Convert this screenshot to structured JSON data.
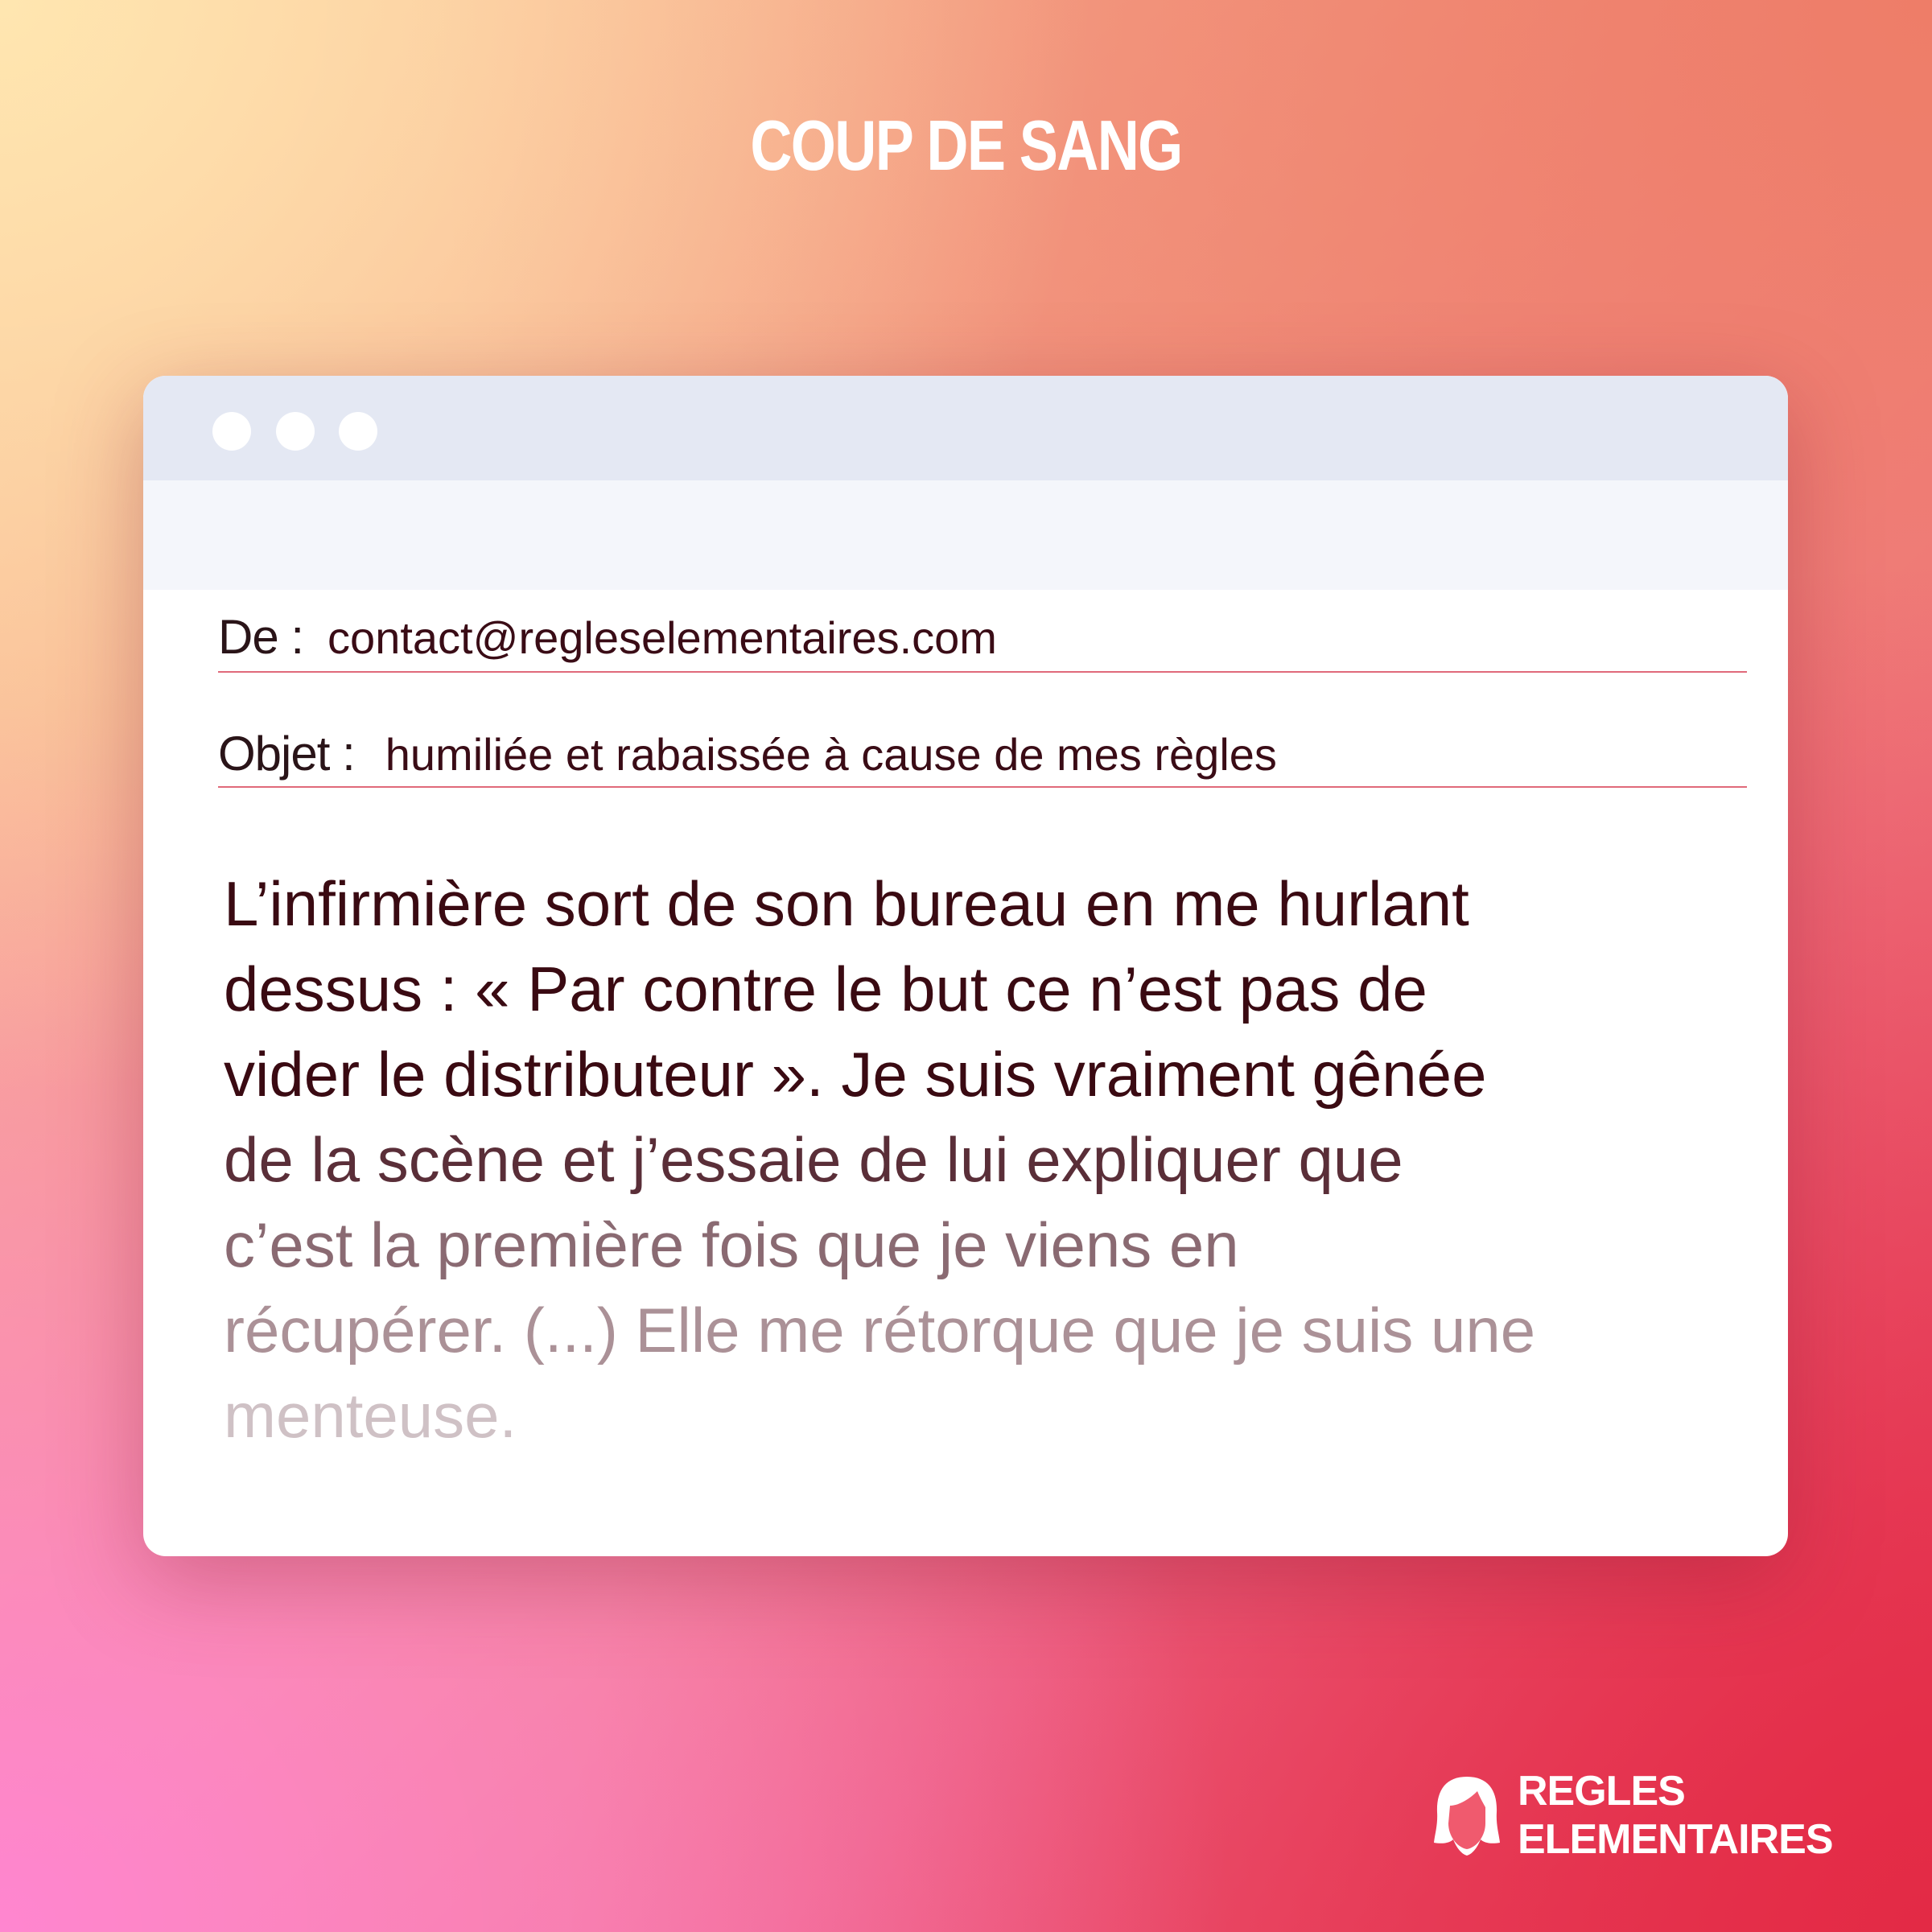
{
  "header": {
    "title": "COUP DE SANG"
  },
  "email": {
    "from_label": "De :",
    "from_value": "contact@regleselementaires.com",
    "subject_label": "Objet :",
    "subject_value": "humiliée et rabaissée à cause de mes règles",
    "body_lines": [
      "L’infirmière sort de son bureau en me hurlant",
      "dessus : « Par contre le but ce n’est pas de",
      "vider le distributeur ». Je suis vraiment gênée",
      "de la scène et j’essaie de lui expliquer que",
      "c’est la première fois que je viens en",
      "récupérer. (...) Elle me rétorque que je suis une",
      "menteuse."
    ],
    "body_colors": [
      "#3a0a12",
      "#3a0a12",
      "#3a0a12",
      "#5a2e38",
      "#8a6a72",
      "#ab9197",
      "#cfc1c5"
    ]
  },
  "logo": {
    "line1": "REGLES",
    "line2": "ELEMENTAIRES",
    "icon": "woman-head-icon"
  }
}
